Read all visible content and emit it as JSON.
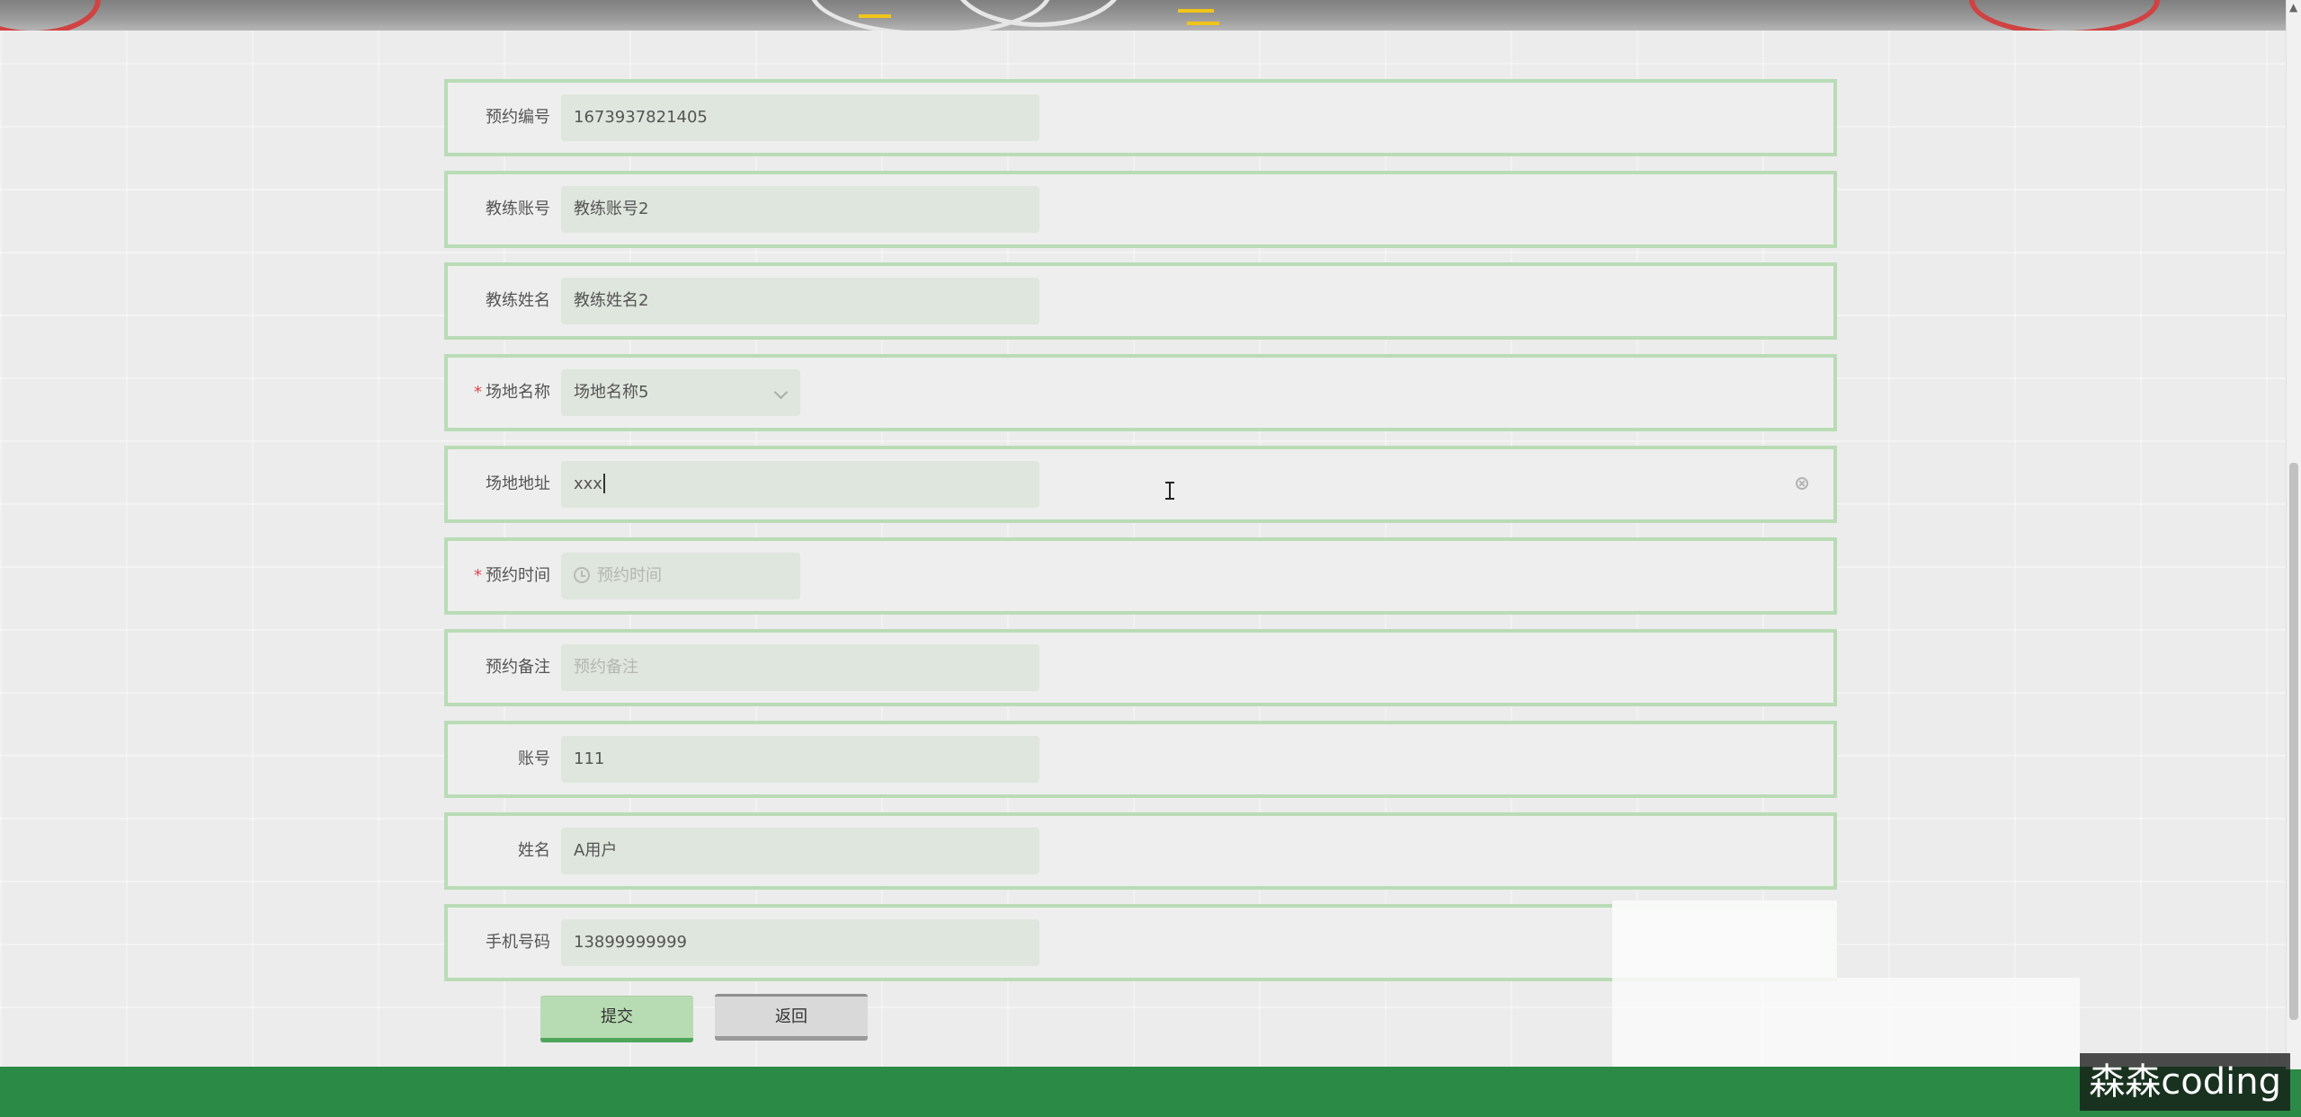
{
  "form": {
    "fields": [
      {
        "label": "预约编号",
        "value": "1673937821405"
      },
      {
        "label": "教练账号",
        "value": "教练账号2"
      },
      {
        "label": "教练姓名",
        "value": "教练姓名2"
      },
      {
        "label": "场地名称",
        "value": "场地名称5"
      },
      {
        "label": "场地地址",
        "value": "xxx"
      },
      {
        "label": "预约时间",
        "placeholder": "预约时间"
      },
      {
        "label": "预约备注",
        "placeholder": "预约备注"
      },
      {
        "label": "账号",
        "value": "111"
      },
      {
        "label": "姓名",
        "value": "A用户"
      },
      {
        "label": "手机号码",
        "value": "13899999999"
      }
    ],
    "required_marker": "*"
  },
  "buttons": {
    "submit": "提交",
    "back": "返回"
  },
  "watermark": "森森coding",
  "colors": {
    "row_border": "#b9dcb6",
    "submit_bg": "#b7dbb2",
    "footer": "#2a8a46"
  }
}
